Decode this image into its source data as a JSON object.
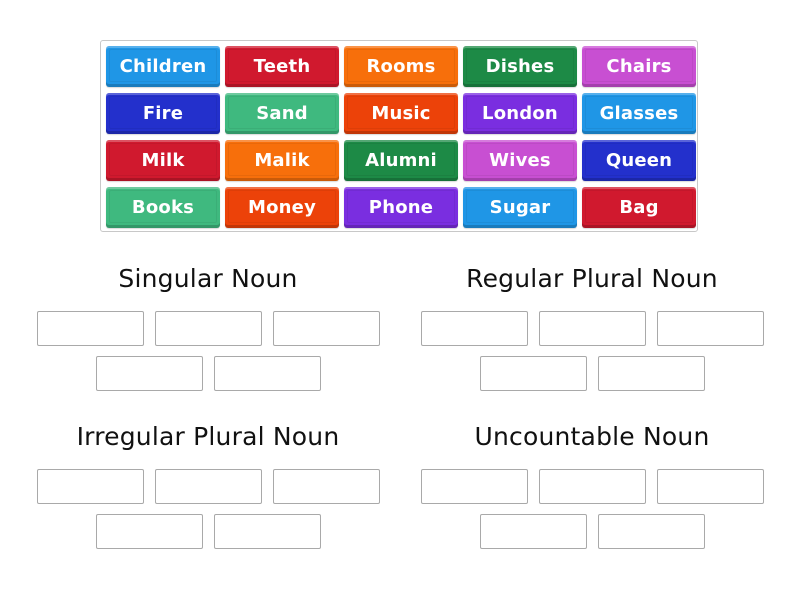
{
  "tiles": [
    {
      "label": "Children",
      "color": "#1f96e6"
    },
    {
      "label": "Teeth",
      "color": "#d0192e"
    },
    {
      "label": "Rooms",
      "color": "#f76f0b"
    },
    {
      "label": "Dishes",
      "color": "#1d8a46"
    },
    {
      "label": "Chairs",
      "color": "#c84fd2"
    },
    {
      "label": "Fire",
      "color": "#2330cc"
    },
    {
      "label": "Sand",
      "color": "#3fb97f"
    },
    {
      "label": "Music",
      "color": "#ec4209"
    },
    {
      "label": "London",
      "color": "#7a2ee0"
    },
    {
      "label": "Glasses",
      "color": "#1f96e6"
    },
    {
      "label": "Milk",
      "color": "#d0192e"
    },
    {
      "label": "Malik",
      "color": "#f76f0b"
    },
    {
      "label": "Alumni",
      "color": "#1d8a46"
    },
    {
      "label": "Wives",
      "color": "#c84fd2"
    },
    {
      "label": "Queen",
      "color": "#2330cc"
    },
    {
      "label": "Books",
      "color": "#3fb97f"
    },
    {
      "label": "Money",
      "color": "#ec4209"
    },
    {
      "label": "Phone",
      "color": "#7a2ee0"
    },
    {
      "label": "Sugar",
      "color": "#1f96e6"
    },
    {
      "label": "Bag",
      "color": "#d0192e"
    }
  ],
  "groups": [
    {
      "title": "Singular Noun",
      "slots": 5
    },
    {
      "title": "Regular Plural Noun",
      "slots": 5
    },
    {
      "title": "Irregular Plural Noun",
      "slots": 5
    },
    {
      "title": "Uncountable Noun",
      "slots": 5
    }
  ],
  "colors": {
    "slot_border": "#a9a9a9",
    "panel_border": "#c8c8c8",
    "heading_text": "#111111"
  }
}
